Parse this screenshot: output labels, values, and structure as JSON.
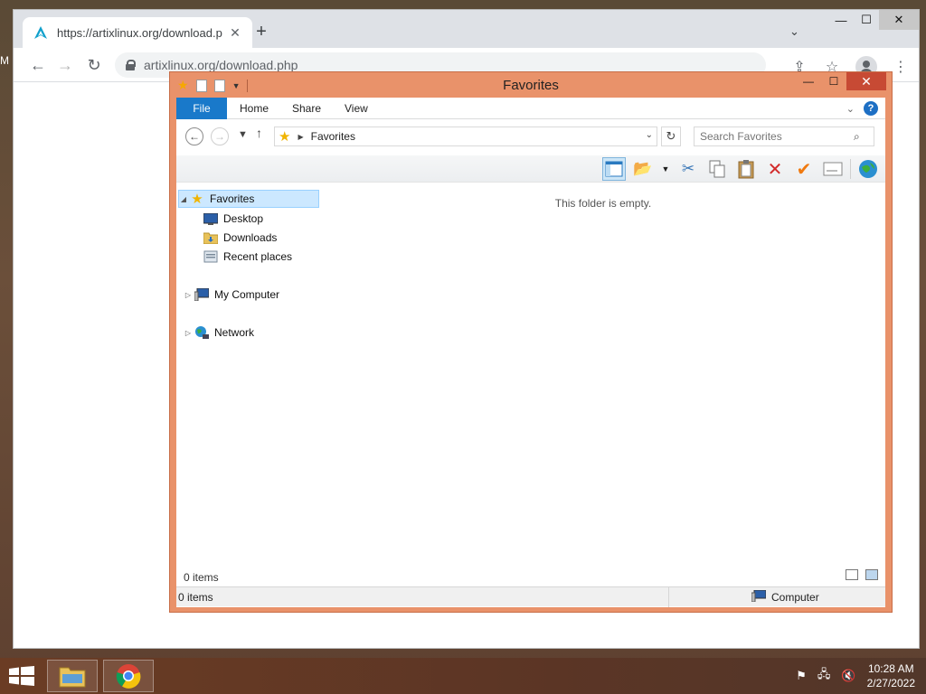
{
  "desktop": {
    "edge_letter": "M"
  },
  "browser": {
    "tab_title": "https://artixlinux.org/download.p",
    "tab_close": "✕",
    "new_tab": "+",
    "url": "artixlinux.org/download.php",
    "window_controls": {
      "minimize": "—",
      "maximize": "☐",
      "close": "✕"
    }
  },
  "explorer": {
    "title": "Favorites",
    "controls": {
      "minimize": "—",
      "maximize": "☐",
      "close": "✕"
    },
    "ribbon_tabs": [
      "File",
      "Home",
      "Share",
      "View"
    ],
    "address_crumb": "Favorites",
    "search_placeholder": "Search Favorites",
    "nav_tree": {
      "favorites": "Favorites",
      "desktop": "Desktop",
      "downloads": "Downloads",
      "recent": "Recent places",
      "computer": "My Computer",
      "network": "Network"
    },
    "empty_message": "This folder is empty.",
    "item_count": "0 items",
    "status_left": "0 items",
    "status_right": "Computer"
  },
  "taskbar": {
    "time": "10:28 AM",
    "date": "2/27/2022"
  },
  "colors": {
    "explorer_frame": "#e9926a",
    "file_tab": "#1979ca",
    "selection": "#cce8ff"
  }
}
